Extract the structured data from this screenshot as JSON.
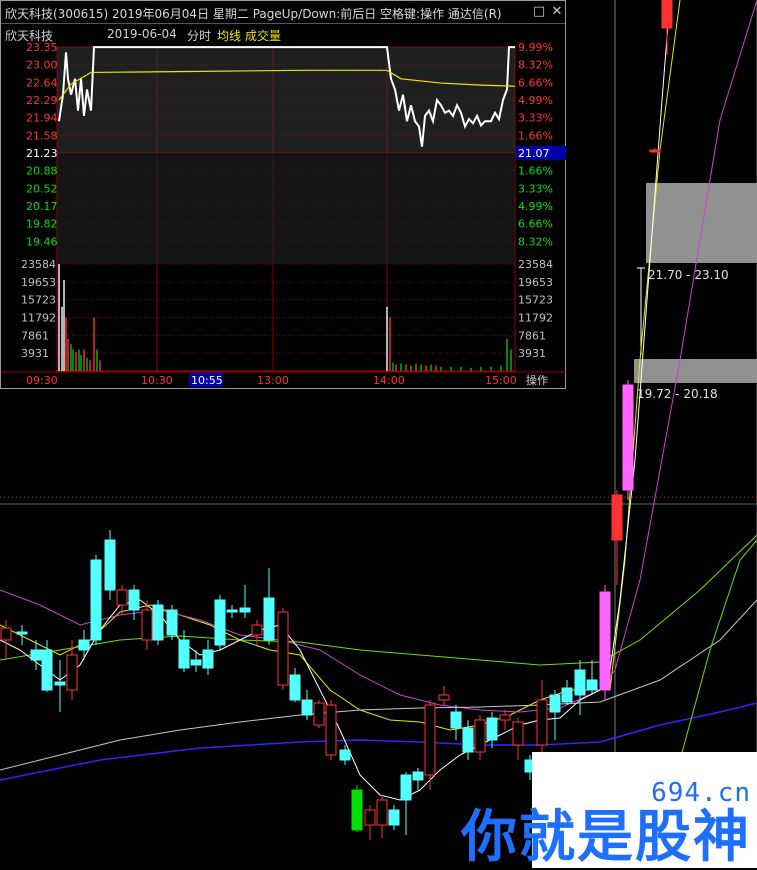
{
  "window": {
    "title": "欣天科技(300615) 2019年06月04日 星期二 PageUp/Down:前后日 空格键:操作 通达信(R)",
    "min_btn": "□",
    "close_btn": "✕"
  },
  "header": {
    "stock_name": "欣天科技",
    "date": "2019-06-04",
    "mode": "分时",
    "avg_label": "均线",
    "vol_label": "成交量",
    "avg_color": "#e8e800",
    "vol_color": "#e8e800"
  },
  "price_axis": {
    "prev_close": "21.23",
    "up_prices": [
      "23.35",
      "23.00",
      "22.64",
      "22.29",
      "21.94",
      "21.58"
    ],
    "down_prices": [
      "20.88",
      "20.52",
      "20.17",
      "19.82",
      "19.46"
    ],
    "up_pcts": [
      "9.99%",
      "8.32%",
      "6.66%",
      "4.99%",
      "3.33%",
      "1.66%"
    ],
    "down_pcts": [
      "1.66%",
      "3.33%",
      "4.99%",
      "6.66%",
      "8.32%"
    ],
    "current": "21.07"
  },
  "vol_axis": [
    "23584",
    "19653",
    "15723",
    "11792",
    "7861",
    "3931"
  ],
  "time_axis": [
    "09:30",
    "10:30",
    "10:55",
    "13:00",
    "14:00",
    "15:00"
  ],
  "operate_label": "操作",
  "colors": {
    "up": "#ff3232",
    "down": "#54ffff",
    "flat": "#ffffff",
    "limit_down": "#00e000",
    "price_line": "#ffffff",
    "avg_line": "#e8e800",
    "grid": "#8b0000"
  },
  "price_labels": {
    "range1": "21.70 - 23.10",
    "range2": "19.72 - 20.18"
  },
  "watermark": {
    "domain": "694.cn",
    "text": "你就是股神"
  }
}
